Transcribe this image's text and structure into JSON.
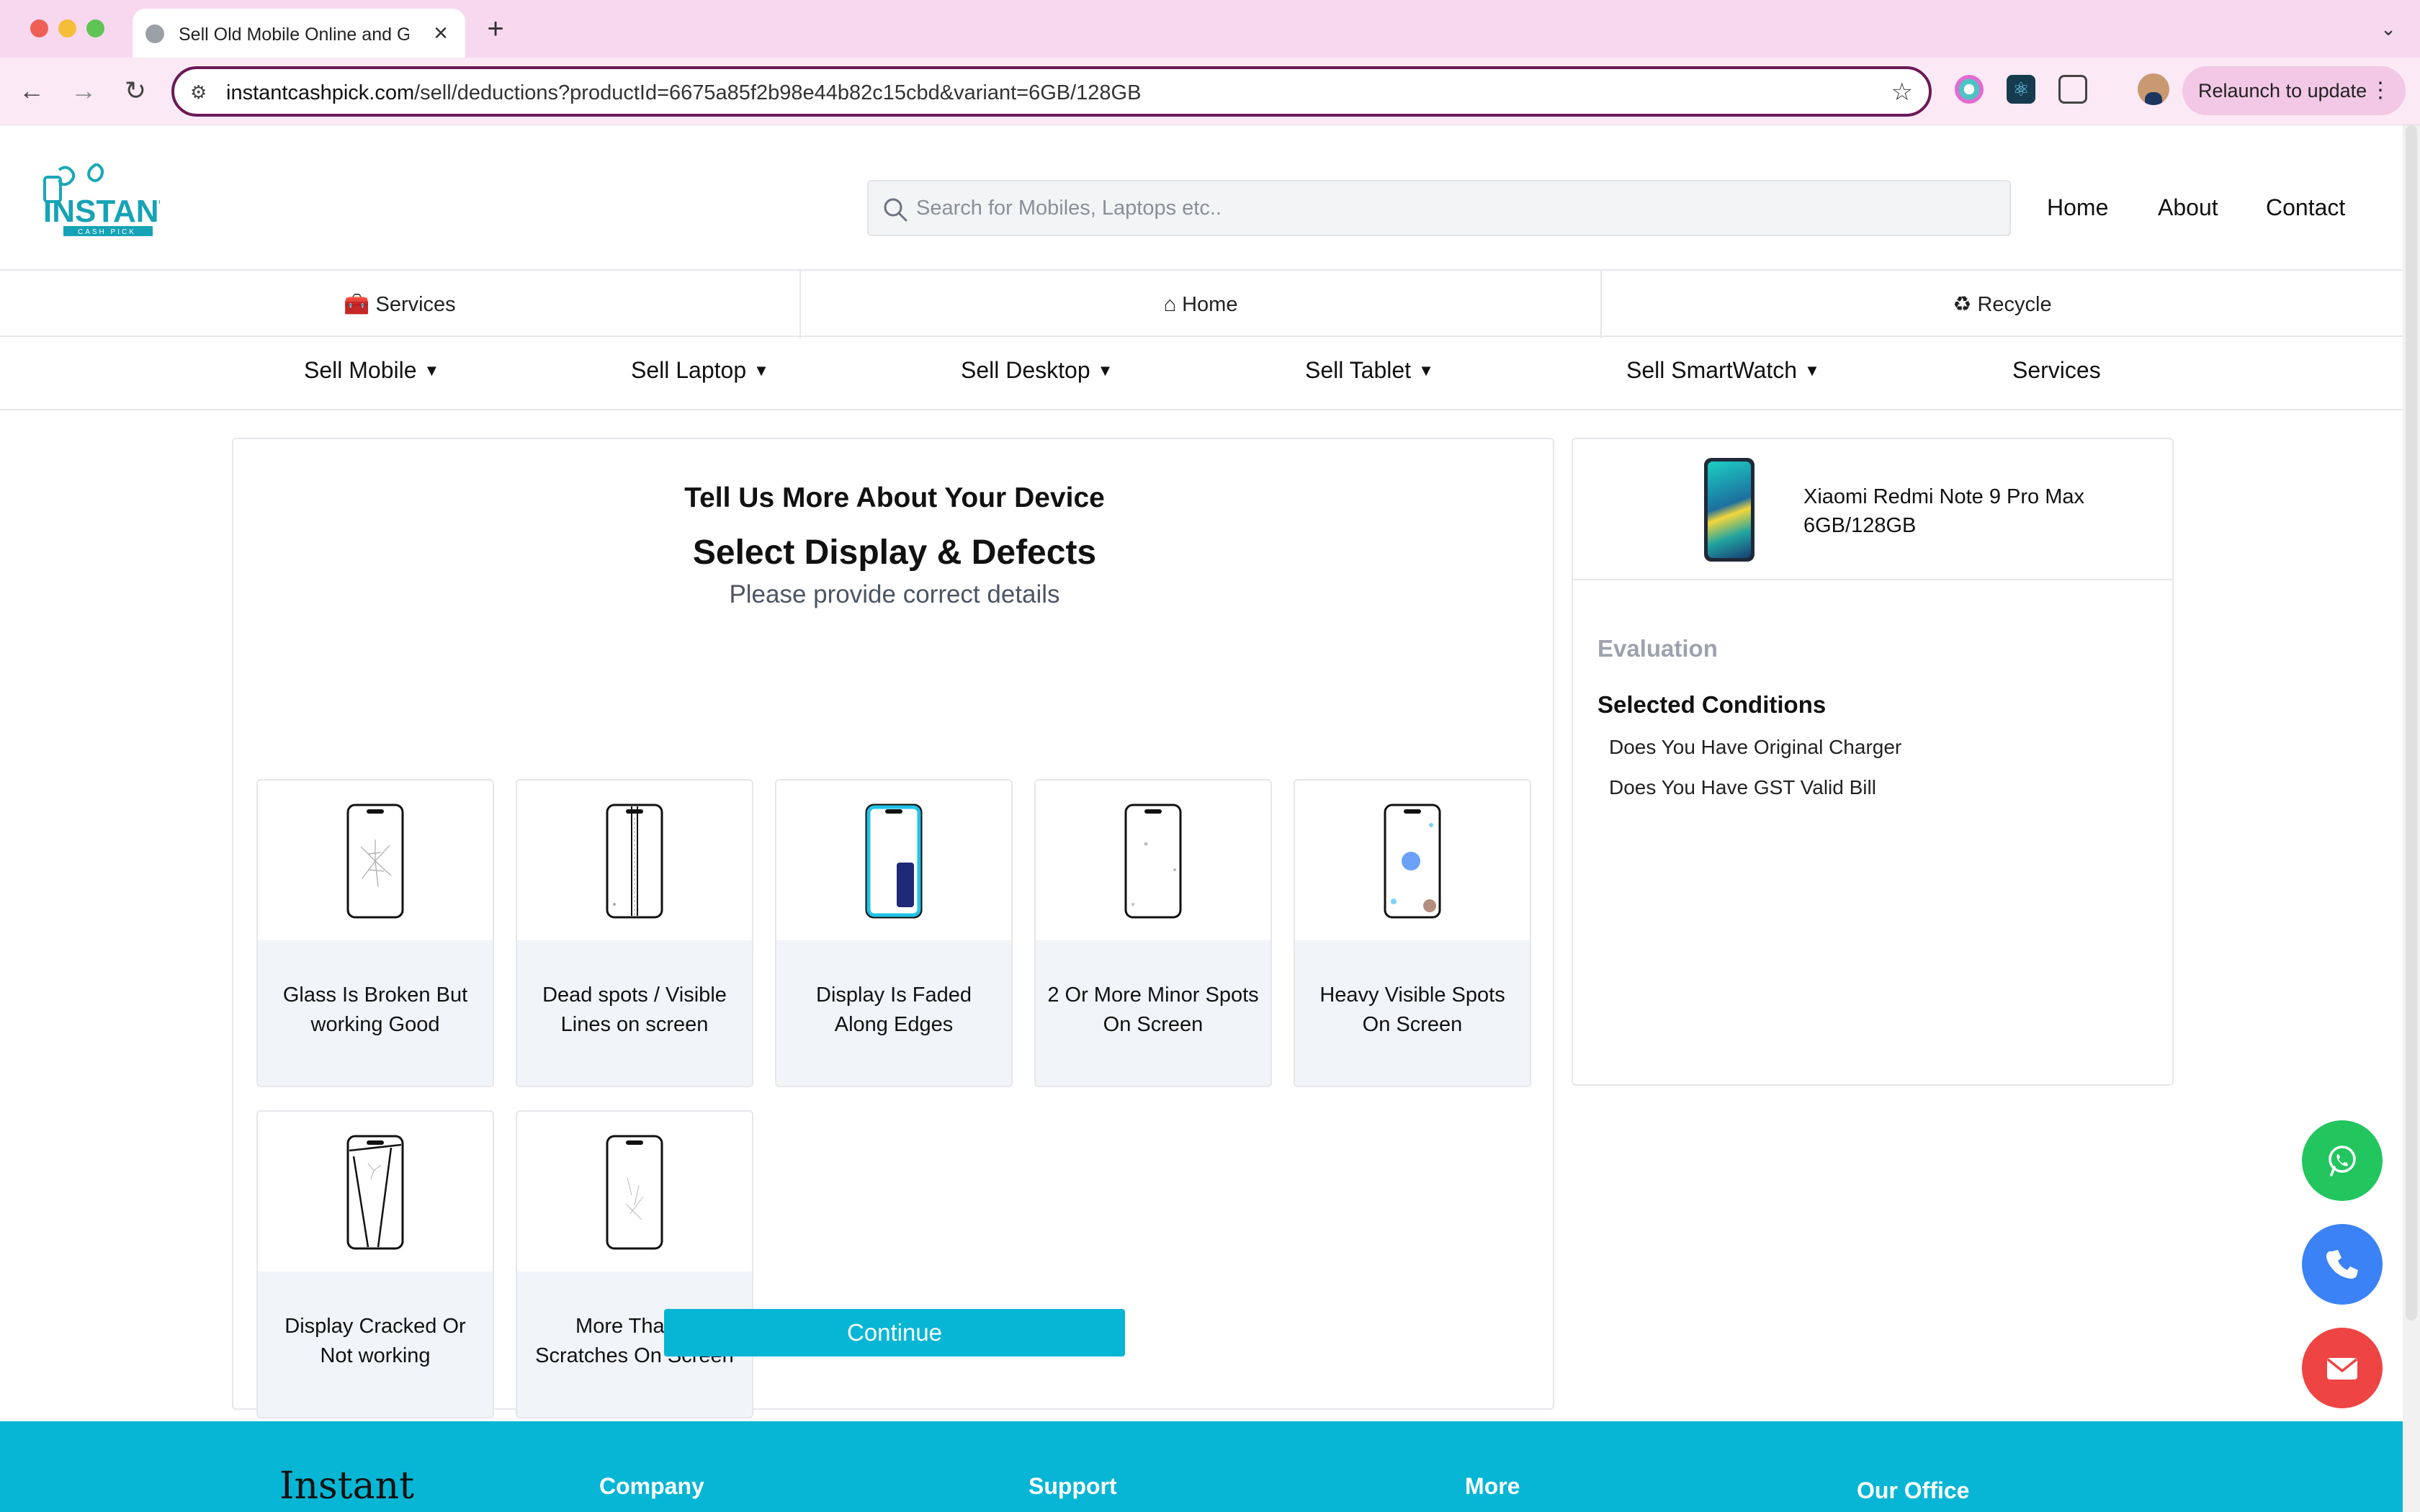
{
  "browser": {
    "tab_title": "Sell Old Mobile Online and Ge",
    "tab_close": "×",
    "new_tab": "+",
    "url_domain": "instantcashpick.com",
    "url_path": "/sell/deductions?productId=6675a85f2b98e44b82c15cbd&variant=6GB/128GB",
    "relaunch_label": "Relaunch to update",
    "menu_dots": "⋮"
  },
  "header": {
    "logo_text": "INSTANT",
    "logo_subtext": "CASH PICK",
    "search_placeholder": "Search for Mobiles, Laptops etc..",
    "nav": [
      "Home",
      "About",
      "Contact"
    ]
  },
  "nav_strip": {
    "services": "Services",
    "home": "Home",
    "recycle": "Recycle"
  },
  "categories": [
    "Sell Mobile",
    "Sell Laptop",
    "Sell Desktop",
    "Sell Tablet",
    "Sell SmartWatch",
    "Services"
  ],
  "main": {
    "heading": "Tell Us More About Your Device",
    "subheading": "Select Display & Defects",
    "hint": "Please provide correct details",
    "options": [
      {
        "label": "Glass Is Broken But working Good",
        "icon": "cracked-glass-phone-icon"
      },
      {
        "label": "Dead spots / Visible Lines on screen",
        "icon": "lines-on-screen-phone-icon"
      },
      {
        "label": "Display Is Faded Along Edges",
        "icon": "faded-edges-phone-icon"
      },
      {
        "label": "2 Or More Minor Spots On Screen",
        "icon": "minor-spots-phone-icon"
      },
      {
        "label": "Heavy Visible Spots On Screen",
        "icon": "heavy-spots-phone-icon"
      },
      {
        "label": "Display Cracked Or Not working",
        "icon": "cracked-display-phone-icon"
      },
      {
        "label": "More Than 3 Scratches On Screen",
        "icon": "scratches-phone-icon"
      }
    ],
    "continue_label": "Continue"
  },
  "summary": {
    "device_name": "Xiaomi Redmi Note 9 Pro Max 6GB/128GB",
    "evaluation_label": "Evaluation",
    "conditions_title": "Selected Conditions",
    "conditions": [
      "Does You Have Original Charger",
      "Does You Have GST Valid Bill"
    ]
  },
  "footer": {
    "brand": "Instant",
    "columns": [
      "Company",
      "Support",
      "More",
      "Our Office"
    ]
  },
  "colors": {
    "accent": "#06b6d4",
    "whatsapp": "#22c55e",
    "call": "#3b82f6",
    "mail": "#ef4444"
  }
}
